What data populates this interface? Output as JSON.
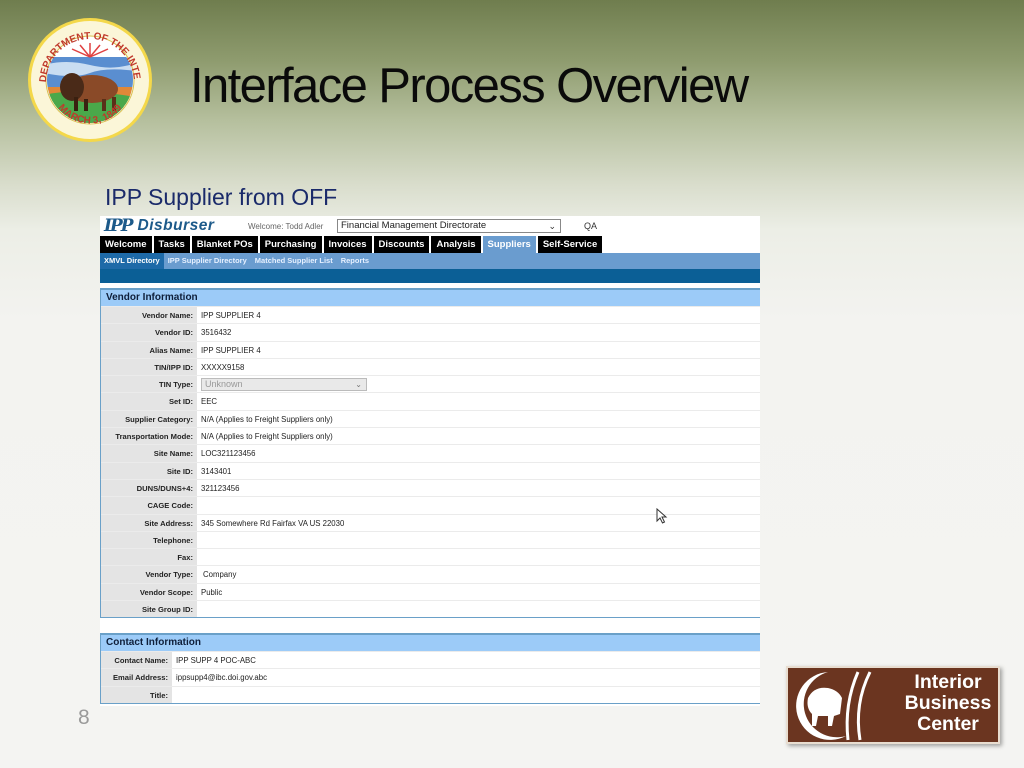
{
  "slide": {
    "title": "Interface Process Overview",
    "subtitle": "IPP Supplier from OFF",
    "page_number": "8",
    "seal": {
      "top_text": "U.S. DEPARTMENT OF THE INTERIOR",
      "bottom_text": "MARCH 3, 1849"
    },
    "ibc_logo": {
      "line1": "Interior",
      "line2": "Business",
      "line3": "Center"
    }
  },
  "app": {
    "logo_mark": "IPP",
    "name": "Disburser",
    "welcome": "Welcome: Todd Adler",
    "org_select": "Financial Management Directorate",
    "environment": "QA",
    "main_nav": [
      {
        "label": "Welcome",
        "active": false
      },
      {
        "label": "Tasks",
        "active": false
      },
      {
        "label": "Blanket POs",
        "active": false
      },
      {
        "label": "Purchasing",
        "active": false
      },
      {
        "label": "Invoices",
        "active": false
      },
      {
        "label": "Discounts",
        "active": false
      },
      {
        "label": "Analysis",
        "active": false
      },
      {
        "label": "Suppliers",
        "active": true
      },
      {
        "label": "Self-Service",
        "active": false
      }
    ],
    "sub_nav": [
      {
        "label": "XMVL Directory",
        "active": true
      },
      {
        "label": "IPP Supplier Directory",
        "active": false
      },
      {
        "label": "Matched Supplier List",
        "active": false
      },
      {
        "label": "Reports",
        "active": false
      }
    ],
    "vendor_info": {
      "heading": "Vendor Information",
      "rows": [
        {
          "label": "Vendor Name:",
          "value": "IPP SUPPLIER 4"
        },
        {
          "label": "Vendor ID:",
          "value": "3516432"
        },
        {
          "label": "Alias Name:",
          "value": "IPP SUPPLIER 4"
        },
        {
          "label": "TIN/IPP ID:",
          "value": "XXXXX9158"
        },
        {
          "label": "TIN Type:",
          "value": "Unknown",
          "type": "select"
        },
        {
          "label": "Set ID:",
          "value": "EEC"
        },
        {
          "label": "Supplier Category:",
          "value": "N/A  (Applies to Freight Suppliers only)"
        },
        {
          "label": "Transportation Mode:",
          "value": "N/A  (Applies to Freight Suppliers only)"
        },
        {
          "label": "Site Name:",
          "value": "LOC321123456"
        },
        {
          "label": "Site ID:",
          "value": "3143401"
        },
        {
          "label": "DUNS/DUNS+4:",
          "value": "321123456"
        },
        {
          "label": "CAGE Code:",
          "value": ""
        },
        {
          "label": "Site Address:",
          "value": "345 Somewhere Rd Fairfax VA US 22030"
        },
        {
          "label": "Telephone:",
          "value": ""
        },
        {
          "label": "Fax:",
          "value": ""
        },
        {
          "label": "Vendor Type:",
          "value": " Company"
        },
        {
          "label": "Vendor Scope:",
          "value": "Public"
        },
        {
          "label": "Site Group ID:",
          "value": ""
        }
      ]
    },
    "contact_info": {
      "heading": "Contact Information",
      "rows": [
        {
          "label": "Contact Name:",
          "value": "IPP SUPP 4 POC-ABC"
        },
        {
          "label": "Email Address:",
          "value": "ippsupp4@ibc.doi.gov.abc"
        },
        {
          "label": "Title:",
          "value": ""
        }
      ]
    }
  },
  "colors": {
    "nav_black": "#000000",
    "nav_active": "#6a9ccf",
    "subnav_active": "#1e6aa8",
    "band": "#0b5f96",
    "panel_header": "#9ccbf8",
    "brand_blue": "#1d5a8a",
    "ibc_brown": "#6b3520"
  }
}
